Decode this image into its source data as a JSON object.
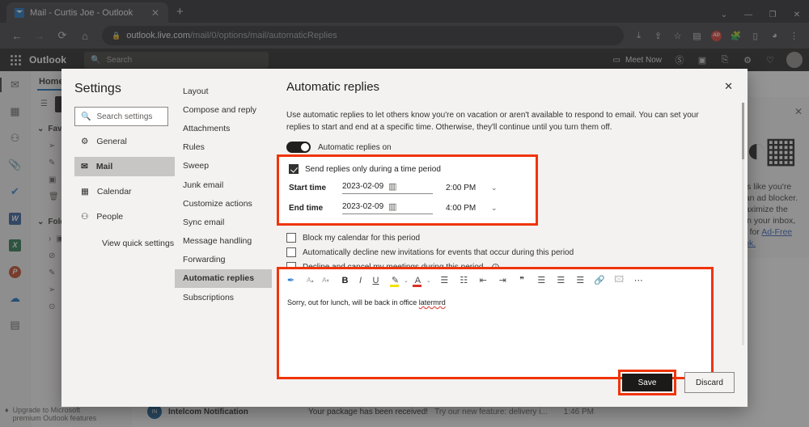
{
  "browser": {
    "tab": {
      "title": "Mail - Curtis Joe - Outlook",
      "close": "✕",
      "favicon": "outlook-icon"
    },
    "newtab": "+",
    "window_controls": [
      "⌄",
      "—",
      "❐",
      "✕"
    ],
    "nav": {
      "back": "←",
      "forward": "→",
      "reload": "⟳",
      "home": "⌂"
    },
    "url_domain": "outlook.live.com",
    "url_path": "/mail/0/options/mail/automaticReplies",
    "lock": "🔒",
    "icons": [
      "download-icon",
      "share-icon",
      "star-icon",
      "reading-list-icon",
      "extension-alert-icon",
      "extensions-icon",
      "split-screen-icon",
      "browser-essentials-icon",
      "menu-icon"
    ],
    "ext_badge": "AD"
  },
  "outlook": {
    "brand": "Outlook",
    "search_placeholder": "Search",
    "meet_now": "Meet Now",
    "top_icons": [
      "skype-icon",
      "teams-icon",
      "notes-icon",
      "settings-gear-icon",
      "tips-bulb-icon"
    ],
    "home_tab": "Home",
    "favorites_label": "Favorites",
    "folders_label": "Folders",
    "promo": "Upgrade to Microsoft premium Outlook features",
    "rail": [
      {
        "name": "mail-icon",
        "glyph": "✉"
      },
      {
        "name": "calendar-icon",
        "glyph": "▦"
      },
      {
        "name": "people-icon",
        "glyph": "👥"
      },
      {
        "name": "files-icon",
        "glyph": "📎"
      },
      {
        "name": "todo-icon",
        "glyph": "✔"
      },
      {
        "name": "word-icon",
        "glyph": "W"
      },
      {
        "name": "excel-icon",
        "glyph": "X"
      },
      {
        "name": "powerpoint-icon",
        "glyph": "P"
      },
      {
        "name": "onedrive-icon",
        "glyph": "☁"
      },
      {
        "name": "apps-icon",
        "glyph": "▤"
      }
    ],
    "message": {
      "avatar": "IN",
      "from": "Intelcom Notification",
      "subject": "Your package has been received!",
      "preview": "Try our new feature: delivery i...",
      "time": "1:46 PM"
    },
    "ad": {
      "close": "✕",
      "text_line1": "oks like you're",
      "text_line2": "g an ad blocker.",
      "text_line3": "maximize the",
      "text_line4": "e in your inbox,",
      "text_line5": "up for",
      "link1": "Ad-Free",
      "link2": "look."
    }
  },
  "settings": {
    "title": "Settings",
    "search_placeholder": "Search settings",
    "nav": [
      {
        "label": "General",
        "icon": "gear-icon",
        "selected": false
      },
      {
        "label": "Mail",
        "icon": "envelope-icon",
        "selected": true
      },
      {
        "label": "Calendar",
        "icon": "calendar-icon",
        "selected": false
      },
      {
        "label": "People",
        "icon": "person-icon",
        "selected": false
      }
    ],
    "quick_settings": "View quick settings",
    "subnav": [
      {
        "label": "Layout",
        "selected": false
      },
      {
        "label": "Compose and reply",
        "selected": false
      },
      {
        "label": "Attachments",
        "selected": false
      },
      {
        "label": "Rules",
        "selected": false
      },
      {
        "label": "Sweep",
        "selected": false
      },
      {
        "label": "Junk email",
        "selected": false
      },
      {
        "label": "Customize actions",
        "selected": false
      },
      {
        "label": "Sync email",
        "selected": false
      },
      {
        "label": "Message handling",
        "selected": false
      },
      {
        "label": "Forwarding",
        "selected": false
      },
      {
        "label": "Automatic replies",
        "selected": true
      },
      {
        "label": "Subscriptions",
        "selected": false
      }
    ]
  },
  "main": {
    "title": "Automatic replies",
    "close": "✕",
    "description": "Use automatic replies to let others know you're on vacation or aren't available to respond to email. You can set your replies to start and end at a specific time. Otherwise, they'll continue until you turn them off.",
    "toggle_label": "Automatic replies on",
    "toggle_on": true,
    "period_checkbox": "Send replies only during a time period",
    "period_checked": true,
    "start_label": "Start time",
    "start_date": "2023-02-09",
    "start_time": "2:00 PM",
    "end_label": "End time",
    "end_date": "2023-02-09",
    "end_time": "4:00 PM",
    "calendar_icon": "▥",
    "chevron": "⌄",
    "options": [
      {
        "label": "Block my calendar for this period",
        "checked": false,
        "info": false
      },
      {
        "label": "Automatically decline new invitations for events that occur during this period",
        "checked": false,
        "info": false
      },
      {
        "label": "Decline and cancel my meetings during this period",
        "checked": false,
        "info": true
      }
    ],
    "info_glyph": "i",
    "body_text_prefix": "Sorry, out for lunch, will be back in office ",
    "body_text_typo": "latermrd",
    "save_label": "Save",
    "discard_label": "Discard",
    "toolbar": [
      {
        "name": "format-painter-icon",
        "glyph": "✎"
      },
      {
        "name": "font-size-grow-icon",
        "glyph": "A"
      },
      {
        "name": "font-size-shrink-icon",
        "glyph": "A"
      },
      {
        "name": "bold-icon",
        "glyph": "B"
      },
      {
        "name": "italic-icon",
        "glyph": "I"
      },
      {
        "name": "underline-icon",
        "glyph": "U"
      },
      {
        "name": "highlight-icon",
        "glyph": "✏"
      },
      {
        "name": "font-color-icon",
        "glyph": "A"
      },
      {
        "name": "bullet-list-icon",
        "glyph": "☰"
      },
      {
        "name": "numbered-list-icon",
        "glyph": "☷"
      },
      {
        "name": "decrease-indent-icon",
        "glyph": "⇤"
      },
      {
        "name": "increase-indent-icon",
        "glyph": "⇥"
      },
      {
        "name": "quote-icon",
        "glyph": "❞"
      },
      {
        "name": "align-left-icon",
        "glyph": "☰"
      },
      {
        "name": "align-center-icon",
        "glyph": "☰"
      },
      {
        "name": "align-right-icon",
        "glyph": "☰"
      },
      {
        "name": "link-icon",
        "glyph": "🔗"
      },
      {
        "name": "image-icon",
        "glyph": "🖼"
      },
      {
        "name": "more-options-icon",
        "glyph": "⋯"
      }
    ],
    "accent_highlight": "#f0340a"
  }
}
